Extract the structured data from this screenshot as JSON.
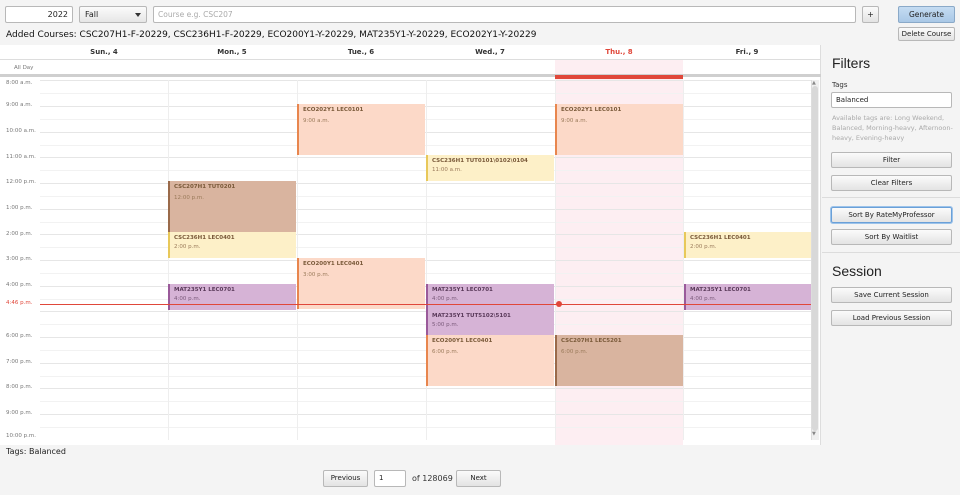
{
  "toolbar": {
    "year_value": "2022",
    "term_value": "Fall",
    "course_placeholder": "Course e.g. CSC207",
    "add_label": "+",
    "generate_label": "Generate",
    "delete_label": "Delete Course"
  },
  "added_courses": "Added Courses: CSC207H1-F-20229, CSC236H1-F-20229, ECO200Y1-Y-20229, MAT235Y1-Y-20229, ECO202Y1-Y-20229",
  "calendar": {
    "days": [
      "Sun., 4",
      "Mon., 5",
      "Tue., 6",
      "Wed., 7",
      "Thu., 8",
      "Fri., 9"
    ],
    "today_index": 4,
    "all_day_label": "All Day",
    "time_labels": [
      "8:00 a.m.",
      "9:00 a.m.",
      "10:00 a.m.",
      "11:00 a.m.",
      "12:00 p.m.",
      "1:00 p.m.",
      "2:00 p.m.",
      "3:00 p.m.",
      "4:00 p.m.",
      "6:00 p.m.",
      "7:00 p.m.",
      "8:00 p.m.",
      "9:00 p.m.",
      "10:00 p.m."
    ],
    "now_label": "4:46 p.m.",
    "events": [
      {
        "title": "ECO202Y1 LEC0101",
        "time": "9:00 a.m."
      },
      {
        "title": "ECO202Y1 LEC0101",
        "time": "9:00 a.m."
      },
      {
        "title": "CSC236H1 TUT0101\\0102\\0104",
        "time": "11:00 a.m."
      },
      {
        "title": "CSC207H1 TUT0201",
        "time": "12:00 p.m."
      },
      {
        "title": "CSC236H1 LEC0401",
        "time": "2:00 p.m."
      },
      {
        "title": "CSC236H1 LEC0401",
        "time": "2:00 p.m."
      },
      {
        "title": "ECO200Y1 LEC0401",
        "time": "3:00 p.m."
      },
      {
        "title": "MAT235Y1 LEC0701",
        "time": "4:00 p.m."
      },
      {
        "title": "MAT235Y1 LEC0701",
        "time": "4:00 p.m."
      },
      {
        "title": "MAT235Y1 LEC0701",
        "time": "4:00 p.m."
      },
      {
        "title": "MAT235Y1 TUT5102\\5101",
        "time": "5:00 p.m."
      },
      {
        "title": "ECO200Y1 LEC0401",
        "time": "6:00 p.m."
      },
      {
        "title": "CSC207H1 LEC5201",
        "time": "6:00 p.m."
      }
    ]
  },
  "footer": {
    "tags_line": "Tags: Balanced"
  },
  "pagination": {
    "previous_label": "Previous",
    "page_value": "1",
    "of_label": "of 128069",
    "next_label": "Next"
  },
  "sidebar": {
    "filters_title": "Filters",
    "tags_label": "Tags",
    "tags_value": "Balanced",
    "tags_help": "Available tags are: Long Weekend, Balanced, Morning-heavy, Afternoon-heavy, Evening-heavy",
    "filter_label": "Filter",
    "clear_filters_label": "Clear Filters",
    "sort_rmp_label": "Sort By RateMyProfessor",
    "sort_waitlist_label": "Sort By Waitlist",
    "session_title": "Session",
    "save_session_label": "Save Current Session",
    "load_session_label": "Load Previous Session"
  },
  "colors": {
    "today_accent": "#e0473a",
    "generate_button": "#a9c8e6",
    "event_salmon": "#fcd9c8",
    "event_brown": "#d9b49f",
    "event_yellow": "#fdf0c8",
    "event_purple": "#d6b3d6"
  }
}
